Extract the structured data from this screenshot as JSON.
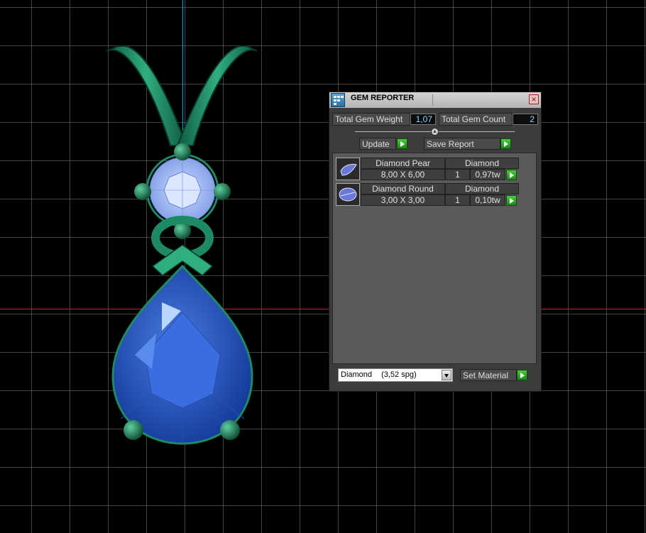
{
  "panel": {
    "title": "GEM REPORTER",
    "total_weight_label": "Total Gem Weight",
    "total_weight_value": "1,07",
    "total_count_label": "Total Gem Count",
    "total_count_value": "2",
    "update_label": "Update",
    "save_report_label": "Save Report",
    "gems": [
      {
        "name": "Diamond Pear",
        "material": "Diamond",
        "size": "8,00 X 6,00",
        "qty": "1",
        "weight": "0,97tw"
      },
      {
        "name": "Diamond Round",
        "material": "Diamond",
        "size": "3,00 X 3,00",
        "qty": "1",
        "weight": "0,10tw"
      }
    ],
    "material_select": {
      "value": "Diamond",
      "spg": "(3,52 spg)"
    },
    "set_material_label": "Set Material"
  },
  "colors": {
    "metal": "#1e8a64",
    "pear_stone": "#2f5fd0",
    "round_stone": "#a8c4ff",
    "grid": "#787878",
    "axis_x": "#b22222",
    "axis_y": "#2aa6c8",
    "accent_green": "#2fae2a"
  }
}
